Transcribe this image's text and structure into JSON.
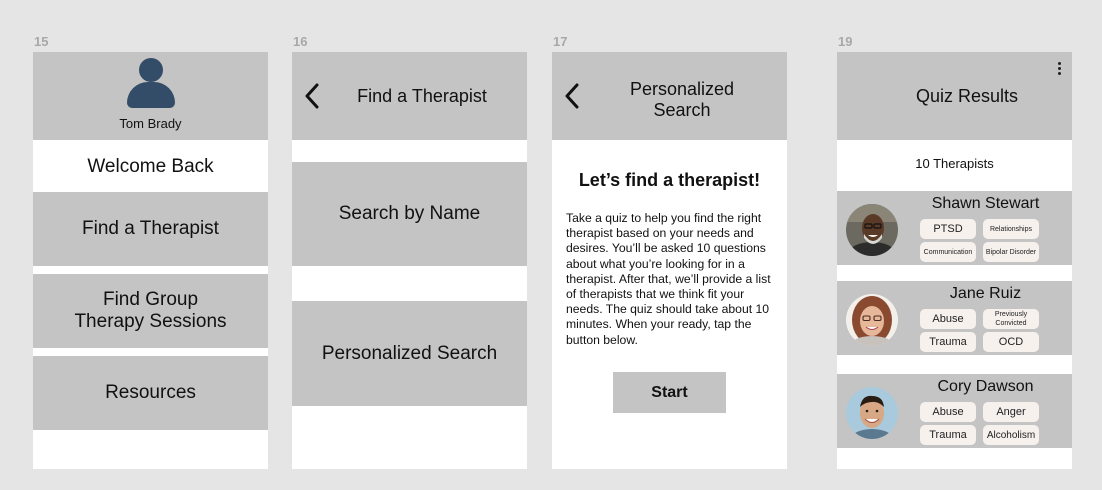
{
  "frames": {
    "f15": {
      "number": "15"
    },
    "f16": {
      "number": "16"
    },
    "f17": {
      "number": "17"
    },
    "f19": {
      "number": "19"
    }
  },
  "colors": {
    "background": "#e5e5e5",
    "block": "#c4c4c4",
    "avatar": "#334c68",
    "tag": "#f7f1ee"
  },
  "home": {
    "user_name": "Tom Brady",
    "welcome": "Welcome Back",
    "menu": [
      {
        "label": "Find a Therapist"
      },
      {
        "label_line1": "Find Group",
        "label_line2": "Therapy Sessions"
      },
      {
        "label": "Resources"
      }
    ]
  },
  "find": {
    "title": "Find a Therapist",
    "options": [
      {
        "label": "Search by Name"
      },
      {
        "label": "Personalized Search"
      }
    ]
  },
  "personalized": {
    "title_line1": "Personalized",
    "title_line2": "Search",
    "heading": "Let’s find a therapist!",
    "body": "Take a quiz to help you find the right therapist based on your needs and desires. You’ll be asked 10 questions about what you’re looking for in a therapist. After that, we’ll provide a list of therapists that we think fit your needs.  The quiz should take about 10 minutes. When your ready, tap the button below.",
    "start_label": "Start"
  },
  "results": {
    "title": "Quiz Results",
    "count": "10 Therapists",
    "therapists": [
      {
        "name": "Shawn Stewart",
        "tags": [
          "PTSD",
          "Relationships",
          "Communication",
          "Bipolar Disorder"
        ]
      },
      {
        "name": "Jane Ruiz",
        "tags": [
          "Abuse",
          "Previously Convicted",
          "Trauma",
          "OCD"
        ]
      },
      {
        "name": "Cory Dawson",
        "tags": [
          "Abuse",
          "Anger",
          "Trauma",
          "Alcoholism"
        ]
      }
    ]
  }
}
